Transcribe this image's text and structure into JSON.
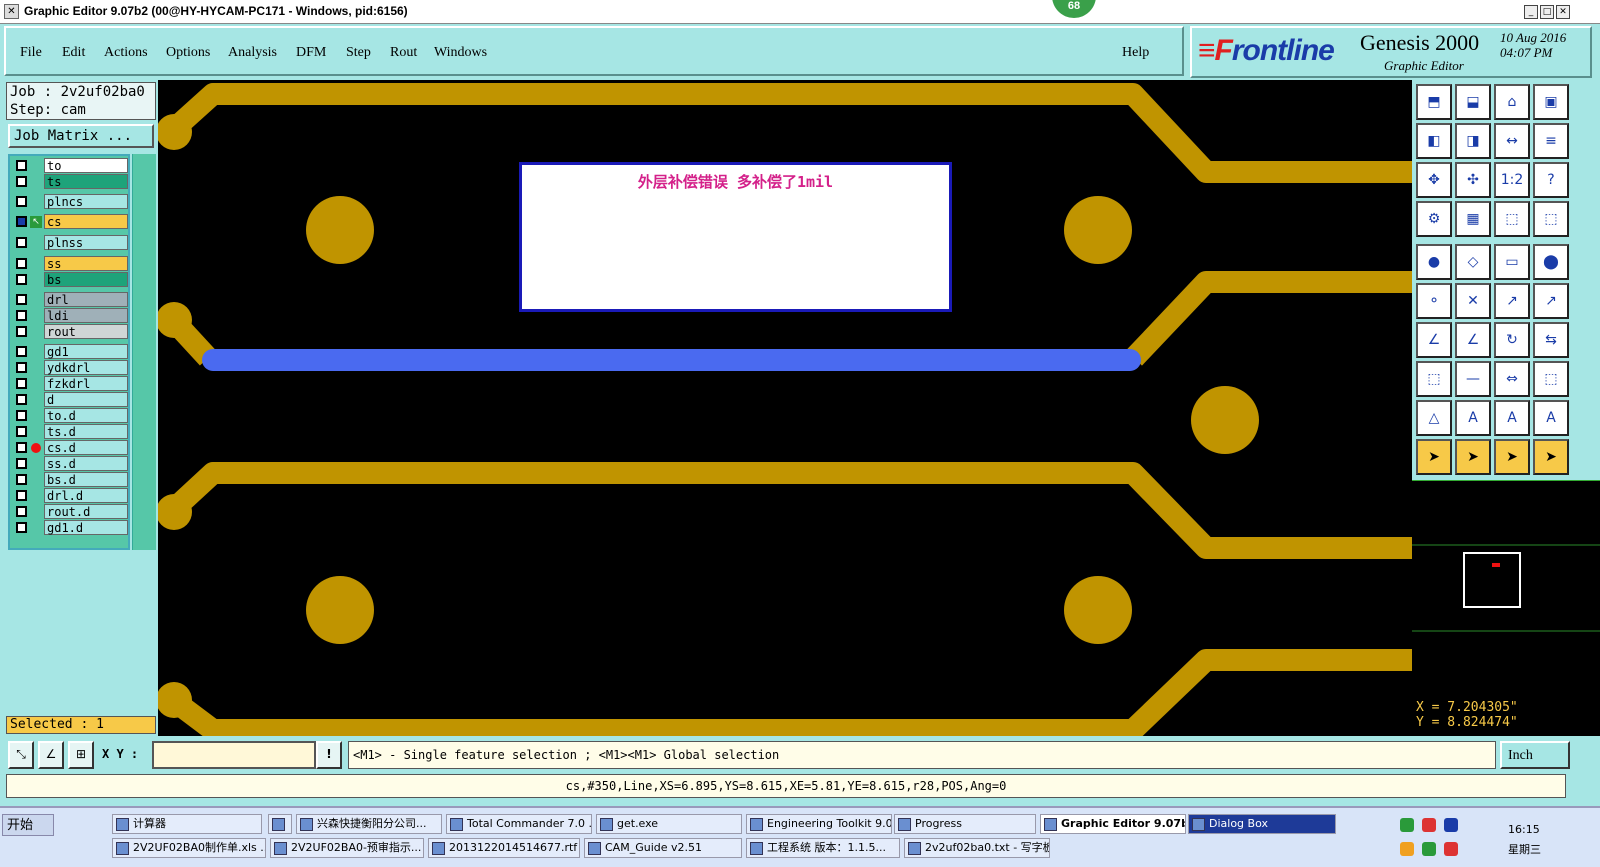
{
  "window": {
    "title": "Graphic Editor 9.07b2 (00@HY-HYCAM-PC171 - Windows, pid:6156)",
    "badge": "68",
    "min": "_",
    "max": "□",
    "close": "✕"
  },
  "menu": {
    "items": [
      "File",
      "Edit",
      "Actions",
      "Options",
      "Analysis",
      "DFM",
      "Step",
      "Rout",
      "Windows"
    ],
    "help": "Help"
  },
  "brand": {
    "logo_mark": "≡F",
    "logo_text": "rontline",
    "product": "Genesis 2000",
    "subtitle": "Graphic Editor",
    "date_line1": "10 Aug 2016",
    "date_line2": "04:07 PM"
  },
  "job": {
    "job_line": "Job : 2v2uf02ba0",
    "step_line": "Step: cam",
    "matrix_button": "Job Matrix ..."
  },
  "layers": [
    "to",
    "ts",
    "plncs",
    "cs",
    "plnss",
    "ss",
    "bs",
    "drl",
    "ldi",
    "rout",
    "gd1",
    "ydkdrl",
    "fzkdrl",
    "d",
    "to.d",
    "ts.d",
    "cs.d",
    "ss.d",
    "bs.d",
    "drl.d",
    "rout.d",
    "gd1.d"
  ],
  "layer_colors": {
    "to": "#ffffff",
    "ts": "#1ea37a",
    "plncs": "#a6e6e4",
    "cs": "#f7c948",
    "plnss": "#a6e6e4",
    "ss": "#f7c948",
    "bs": "#1ea37a",
    "drl": "#9fb0b8",
    "ldi": "#9fb0b8",
    "rout": "#cfd6d6",
    "default": "#a6e6e4"
  },
  "selected_count": "Selected : 1",
  "message": "外层补偿错误  多补偿了1mil",
  "coords": {
    "x": "X = 7.204305\"",
    "y": "Y = 8.824474\""
  },
  "bottom": {
    "xy_label": "X Y :",
    "xy_value": "",
    "hint_icon": "!",
    "hint": "<M1> - Single feature selection ; <M1><M1> Global selection",
    "units": "Inch"
  },
  "status": "cs,#350,Line,XS=6.895,YS=8.615,XE=5.81,YE=8.615,r28,POS,Ang=0",
  "taskbar": {
    "start": "开始",
    "row1": [
      "计算器",
      "",
      "兴森快捷衡阳分公司...",
      "Total Commander 7.0 ...",
      "get.exe",
      "Engineering Toolkit 9.0...",
      "Progress",
      "Graphic Editor 9.07b...",
      "Dialog Box"
    ],
    "row2": [
      "2V2UF02BA0制作单.xls ...",
      "2V2UF02BA0-预审指示...",
      "20131220145146​77.rtf [...",
      "CAM_Guide v2.51",
      "工程系统  版本：1.1.5...",
      "2v2uf02ba0.txt - 写字板"
    ],
    "time": "16:15",
    "day": "星期三"
  },
  "colors": {
    "panel": "#a6e6e4",
    "copper": "#c09400",
    "selected_trace": "#4a6af0",
    "canvas": "#000000",
    "message_text": "#d4208a"
  }
}
